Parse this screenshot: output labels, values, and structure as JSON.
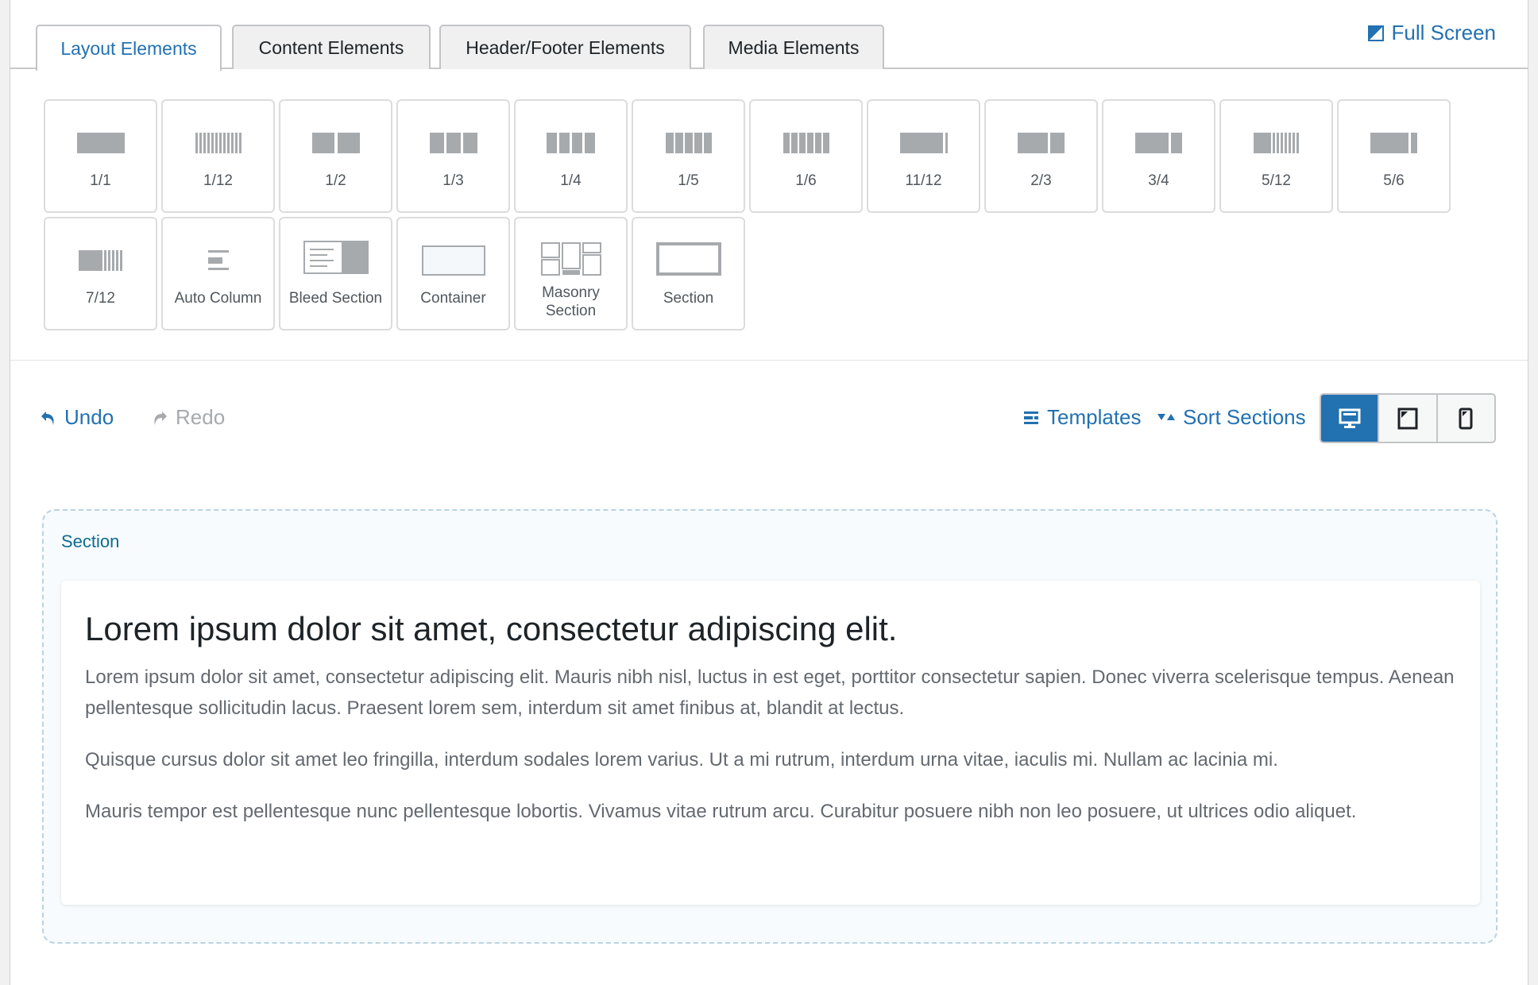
{
  "tabs": [
    {
      "label": "Layout Elements",
      "active": true
    },
    {
      "label": "Content Elements",
      "active": false
    },
    {
      "label": "Header/Footer Elements",
      "active": false
    },
    {
      "label": "Media Elements",
      "active": false
    }
  ],
  "fullscreen": {
    "label": "Full Screen",
    "icon": "fullscreen-icon"
  },
  "elements": [
    {
      "label": "1/1",
      "icon": "column-1-1-icon"
    },
    {
      "label": "1/12",
      "icon": "column-1-12-icon"
    },
    {
      "label": "1/2",
      "icon": "column-1-2-icon"
    },
    {
      "label": "1/3",
      "icon": "column-1-3-icon"
    },
    {
      "label": "1/4",
      "icon": "column-1-4-icon"
    },
    {
      "label": "1/5",
      "icon": "column-1-5-icon"
    },
    {
      "label": "1/6",
      "icon": "column-1-6-icon"
    },
    {
      "label": "11/12",
      "icon": "column-11-12-icon"
    },
    {
      "label": "2/3",
      "icon": "column-2-3-icon"
    },
    {
      "label": "3/4",
      "icon": "column-3-4-icon"
    },
    {
      "label": "5/12",
      "icon": "column-5-12-icon"
    },
    {
      "label": "5/6",
      "icon": "column-5-6-icon"
    },
    {
      "label": "7/12",
      "icon": "column-7-12-icon"
    },
    {
      "label": "Auto Column",
      "icon": "auto-column-icon"
    },
    {
      "label": "Bleed Section",
      "icon": "bleed-section-icon"
    },
    {
      "label": "Container",
      "icon": "container-icon"
    },
    {
      "label": "Masonry Section",
      "icon": "masonry-section-icon"
    },
    {
      "label": "Section",
      "icon": "section-icon"
    }
  ],
  "toolbar": {
    "undo": "Undo",
    "redo": "Redo",
    "templates": "Templates",
    "sort_sections": "Sort Sections",
    "views": [
      {
        "name": "desktop",
        "icon": "desktop-icon",
        "active": true
      },
      {
        "name": "tablet",
        "icon": "tablet-icon",
        "active": false
      },
      {
        "name": "mobile",
        "icon": "mobile-icon",
        "active": false
      }
    ]
  },
  "section": {
    "label": "Section",
    "heading": "Lorem ipsum dolor sit amet, consectetur adipiscing elit.",
    "paragraphs": [
      "Lorem ipsum dolor sit amet, consectetur adipiscing elit. Mauris nibh nisl, luctus in est eget, porttitor consectetur sapien. Donec viverra scelerisque tempus. Aenean pellentesque sollicitudin lacus. Praesent lorem sem, interdum sit amet finibus at, blandit at lectus.",
      "Quisque cursus dolor sit amet leo fringilla, interdum sodales lorem varius. Ut a mi rutrum, interdum urna vitae, iaculis mi. Nullam ac lacinia mi.",
      "Mauris tempor est pellentesque nunc pellentesque lobortis. Vivamus vitae rutrum arcu. Curabitur posuere nibh non leo posuere, ut ultrices odio aliquet."
    ]
  },
  "colors": {
    "accent": "#2271b1",
    "section_label": "#0e6b8f",
    "muted": "#a7aaad",
    "icon_gray": "#a7aaad"
  }
}
